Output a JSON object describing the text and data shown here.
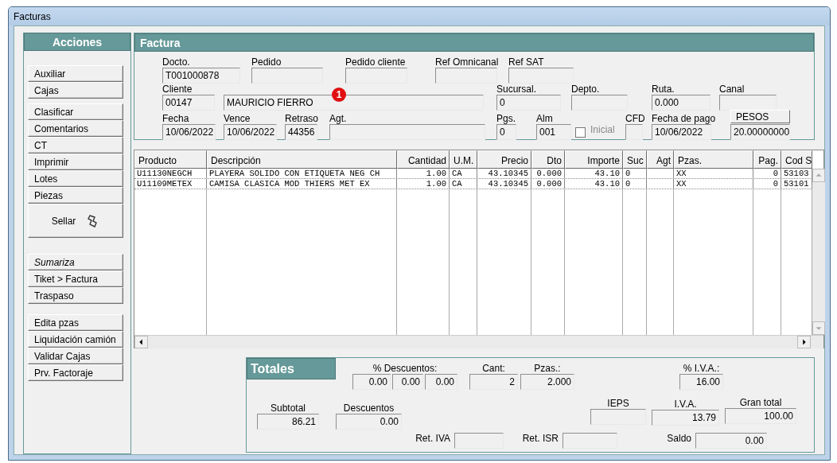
{
  "window": {
    "title": "Facturas"
  },
  "sidebar": {
    "title": "Acciones",
    "groups": [
      [
        {
          "label": "Auxiliar",
          "kind": "button"
        },
        {
          "label": "Cajas",
          "kind": "button"
        }
      ],
      [
        {
          "label": "Clasificar",
          "kind": "button"
        },
        {
          "label": "Comentarios",
          "kind": "button"
        },
        {
          "label": "CT",
          "kind": "button"
        },
        {
          "label": "Imprimir",
          "kind": "button"
        },
        {
          "label": "Lotes",
          "kind": "button"
        },
        {
          "label": "Piezas",
          "kind": "button"
        },
        {
          "label": "Sellar",
          "kind": "large"
        }
      ],
      [
        {
          "label": "Sumariza",
          "kind": "italic"
        },
        {
          "label": "Tiket > Factura",
          "kind": "button"
        },
        {
          "label": "Traspaso",
          "kind": "button"
        }
      ],
      [
        {
          "label": "Edita pzas",
          "kind": "button"
        },
        {
          "label": "Liquidación camión",
          "kind": "button"
        },
        {
          "label": "Validar Cajas",
          "kind": "button"
        },
        {
          "label": "Prv. Factoraje",
          "kind": "button"
        }
      ]
    ]
  },
  "factura": {
    "title": "Factura",
    "fields": [
      {
        "kind": "field",
        "label": "Docto.",
        "value": "T001000878"
      },
      {
        "kind": "field",
        "label": "Pedido"
      },
      {
        "kind": "field",
        "label": "Pedido cliente"
      },
      {
        "kind": "field",
        "label": "Ref Omnicanal"
      },
      {
        "kind": "field",
        "label": "Ref SAT"
      },
      {
        "kind": "field",
        "label": "Cliente",
        "value": "00147"
      },
      {
        "kind": "field",
        "value": "MAURICIO FIERRO",
        "badge": "1"
      },
      {
        "kind": "field",
        "label": "Sucursal.",
        "value": "0"
      },
      {
        "kind": "field",
        "label": "Depto."
      },
      {
        "kind": "field",
        "label": "Ruta.",
        "value": "0.000"
      },
      {
        "kind": "field",
        "label": "Canal"
      },
      {
        "kind": "field",
        "label": "Fecha",
        "value": "10/06/2022"
      },
      {
        "kind": "field",
        "label": "Vence",
        "value": "10/06/2022"
      },
      {
        "kind": "field",
        "label": "Retraso",
        "value": "44356"
      },
      {
        "kind": "field",
        "label": "Agt."
      },
      {
        "kind": "field",
        "label": "Pgs.",
        "value": "0"
      },
      {
        "kind": "field",
        "label": "Alm",
        "value": "001"
      },
      {
        "kind": "checkbox",
        "label": "Inicial",
        "checked": false,
        "disabled": true
      },
      {
        "kind": "field",
        "label": "CFD"
      },
      {
        "kind": "field",
        "label": "Fecha de pago",
        "value": "10/06/2022"
      },
      {
        "kind": "currency",
        "button": "PESOS",
        "value": "20.00000000"
      }
    ]
  },
  "table": {
    "columns": [
      "Producto",
      "Descripción",
      "Cantidad",
      "U.M.",
      "Precio",
      "Dto",
      "Importe",
      "Suc",
      "Agt",
      "Pzas.",
      "Pag.",
      "Cod S"
    ],
    "rows": [
      [
        "U11130NEGCH",
        "PLAYERA SOLIDO CON ETIQUETA NEG CH",
        "1.00",
        "CA",
        "43.10345",
        "0.000",
        "43.10",
        "0",
        "",
        "XX",
        "0",
        "53103"
      ],
      [
        "U11109METEX",
        "CAMISA CLASICA MOD THIERS MET EX",
        "1.00",
        "CA",
        "43.10345",
        "0.000",
        "43.10",
        "0",
        "",
        "XX",
        "0",
        "53101"
      ]
    ]
  },
  "totals": {
    "title": "Totales",
    "discounts": {
      "label": "% Descuentos:",
      "values": [
        "0.00",
        "0.00",
        "0.00"
      ]
    },
    "cant": {
      "label": "Cant:",
      "value": "2"
    },
    "pzas": {
      "label": "Pzas.:",
      "value": "2.000"
    },
    "iva_rate": {
      "label": "% I.V.A.:",
      "value": "16.00"
    },
    "subtotal": {
      "label": "Subtotal",
      "value": "86.21"
    },
    "descuentos": {
      "label": "Descuentos",
      "value": "0.00"
    },
    "ieps": {
      "label": "IEPS"
    },
    "iva": {
      "label": "I.V.A.",
      "value": "13.79"
    },
    "gran_total": {
      "label": "Gran total",
      "value": "100.00"
    },
    "ret_iva": {
      "label": "Ret. IVA"
    },
    "ret_isr": {
      "label": "Ret. ISR"
    },
    "saldo": {
      "label": "Saldo",
      "value": "0.00"
    }
  }
}
